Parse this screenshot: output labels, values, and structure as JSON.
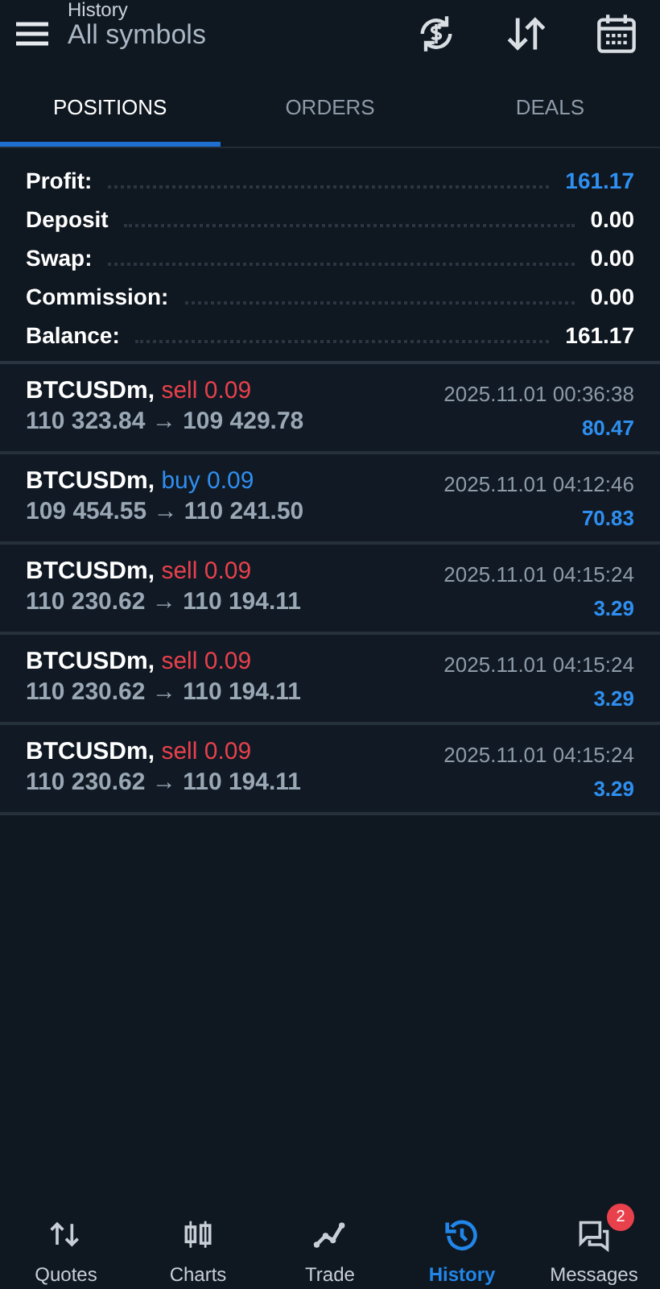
{
  "header": {
    "title": "History",
    "subtitle": "All symbols"
  },
  "tabs": [
    {
      "label": "POSITIONS",
      "selected": true
    },
    {
      "label": "ORDERS",
      "selected": false
    },
    {
      "label": "DEALS",
      "selected": false
    }
  ],
  "summary": [
    {
      "label": "Profit:",
      "value": "161.17",
      "kind": "profit"
    },
    {
      "label": "Deposit",
      "value": "0.00",
      "kind": "plain"
    },
    {
      "label": "Swap:",
      "value": "0.00",
      "kind": "plain"
    },
    {
      "label": "Commission:",
      "value": "0.00",
      "kind": "plain"
    },
    {
      "label": "Balance:",
      "value": "161.17",
      "kind": "plain"
    }
  ],
  "positions": [
    {
      "symbol": "BTCUSDm,",
      "order": "sell 0.09",
      "kind": "sell",
      "prices": "110 323.84 → 109 429.78",
      "time": "2025.11.01 00:36:38",
      "profit": "80.47"
    },
    {
      "symbol": "BTCUSDm,",
      "order": "buy 0.09",
      "kind": "buy",
      "prices": "109 454.55 → 110 241.50",
      "time": "2025.11.01 04:12:46",
      "profit": "70.83"
    },
    {
      "symbol": "BTCUSDm,",
      "order": "sell 0.09",
      "kind": "sell",
      "prices": "110 230.62 → 110 194.11",
      "time": "2025.11.01 04:15:24",
      "profit": "3.29"
    },
    {
      "symbol": "BTCUSDm,",
      "order": "sell 0.09",
      "kind": "sell",
      "prices": "110 230.62 → 110 194.11",
      "time": "2025.11.01 04:15:24",
      "profit": "3.29"
    },
    {
      "symbol": "BTCUSDm,",
      "order": "sell 0.09",
      "kind": "sell",
      "prices": "110 230.62 → 110 194.11",
      "time": "2025.11.01 04:15:24",
      "profit": "3.29"
    }
  ],
  "nav": [
    {
      "label": "Quotes",
      "kind": "quotes",
      "selected": false
    },
    {
      "label": "Charts",
      "kind": "charts",
      "selected": false
    },
    {
      "label": "Trade",
      "kind": "trade",
      "selected": false
    },
    {
      "label": "History",
      "kind": "history",
      "selected": true
    },
    {
      "label": "Messages",
      "kind": "messages",
      "selected": false,
      "badge": "2"
    }
  ]
}
